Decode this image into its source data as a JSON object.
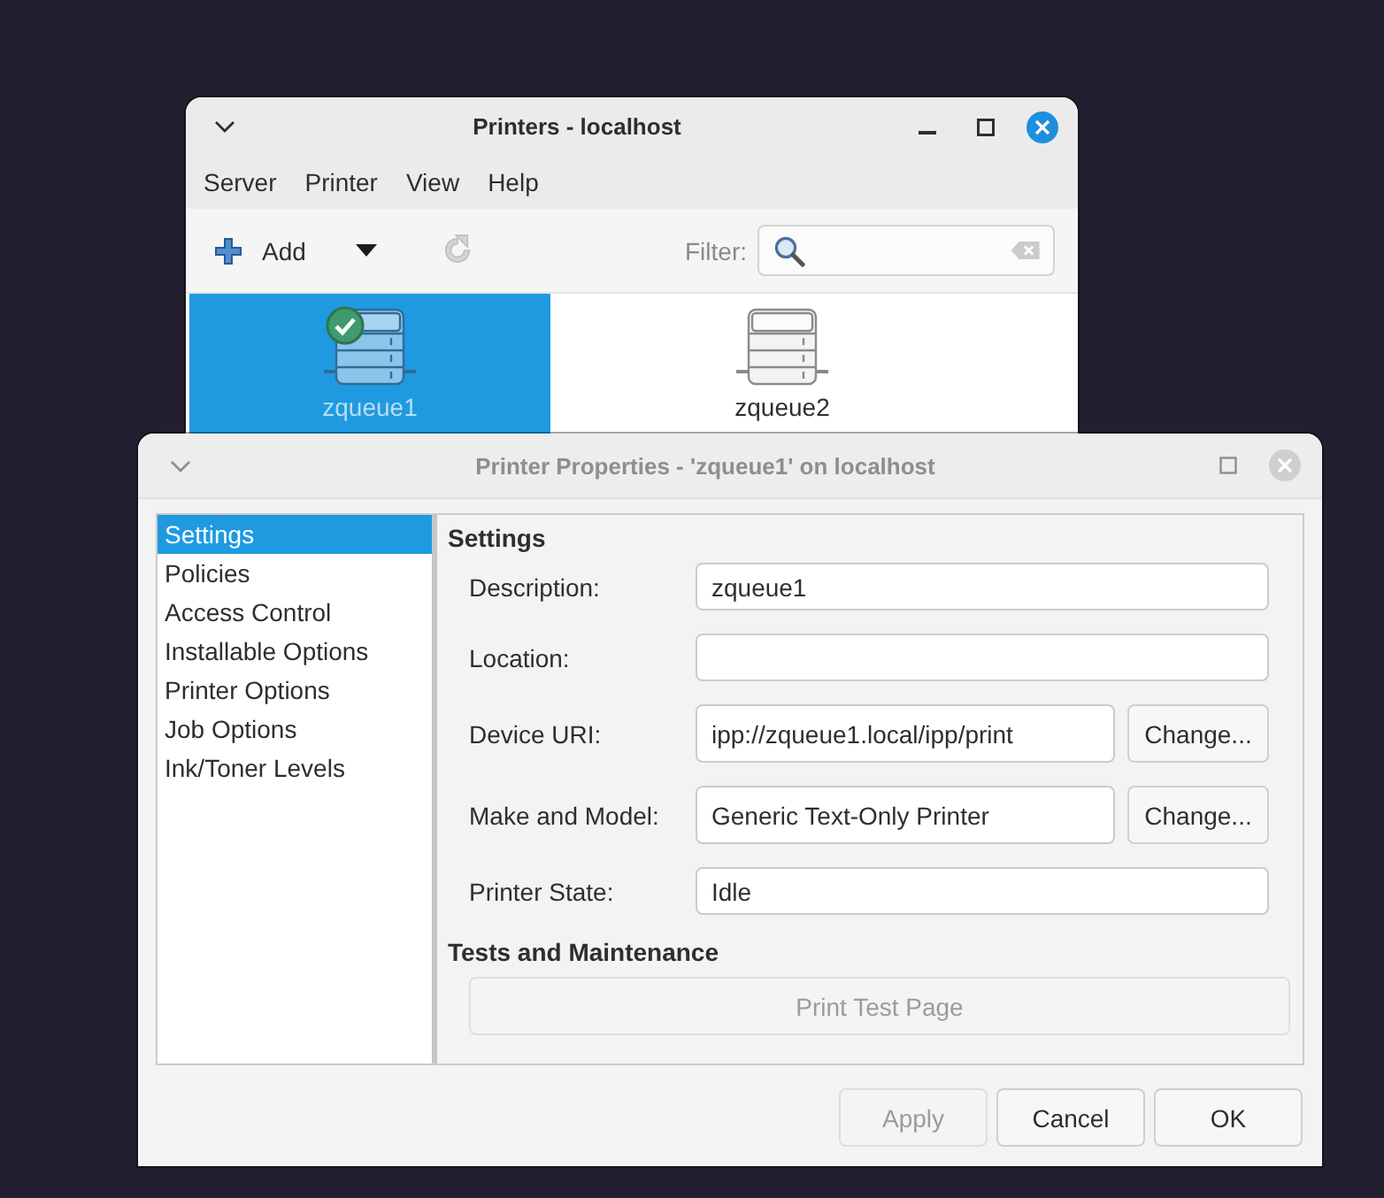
{
  "printers_window": {
    "title": "Printers - localhost",
    "active": true,
    "controls": [
      {
        "kind": "minimize"
      },
      {
        "kind": "maximize"
      },
      {
        "kind": "close"
      }
    ],
    "menu": [
      "Server",
      "Printer",
      "View",
      "Help"
    ],
    "toolbar": [
      {
        "kind": "add",
        "label": "Add",
        "disabled": false
      },
      {
        "kind": "dropdown",
        "disabled": false
      },
      {
        "kind": "refresh",
        "disabled": true
      }
    ],
    "filter": {
      "label": "Filter:"
    },
    "printers": [
      {
        "name": "zqueue1",
        "selected": true,
        "default": true
      },
      {
        "name": "zqueue2",
        "selected": false,
        "default": false
      }
    ]
  },
  "dialog": {
    "title": "Printer Properties - 'zqueue1' on localhost",
    "active": false,
    "controls": [
      {
        "kind": "maximize"
      },
      {
        "kind": "close"
      }
    ],
    "sidebar": [
      {
        "label": "Settings",
        "selected": true
      },
      {
        "label": "Policies",
        "selected": false
      },
      {
        "label": "Access Control",
        "selected": false
      },
      {
        "label": "Installable Options",
        "selected": false
      },
      {
        "label": "Printer Options",
        "selected": false
      },
      {
        "label": "Job Options",
        "selected": false
      },
      {
        "label": "Ink/Toner Levels",
        "selected": false
      }
    ],
    "sections": [
      {
        "kind": "form",
        "title": "Settings",
        "fields": [
          {
            "label": "Description:",
            "value": "zqueue1"
          },
          {
            "label": "Location:"
          },
          {
            "label": "Device URI:",
            "value": "ipp://zqueue1.local/ipp/print",
            "button": "Change..."
          },
          {
            "label": "Make and Model:",
            "value": "Generic Text-Only Printer",
            "button": "Change..."
          },
          {
            "label": "Printer State:",
            "value": "Idle"
          }
        ]
      },
      {
        "kind": "actions",
        "title": "Tests and Maintenance",
        "buttons": [
          {
            "label": "Print Test Page",
            "disabled": true
          }
        ]
      }
    ],
    "buttons": [
      {
        "label": "Apply",
        "disabled": true
      },
      {
        "label": "Cancel",
        "disabled": false
      },
      {
        "label": "OK",
        "disabled": false
      }
    ]
  }
}
